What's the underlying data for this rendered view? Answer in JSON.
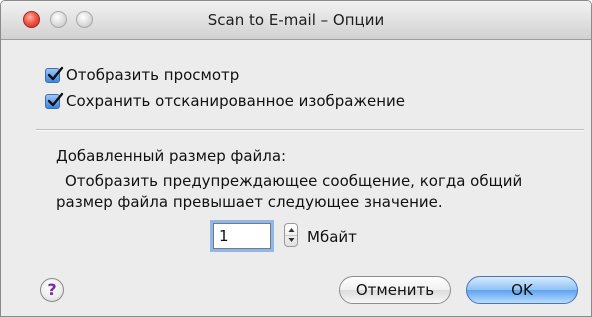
{
  "window": {
    "title": "Scan to E-mail – Опции"
  },
  "options": {
    "show_preview": {
      "label": "Отобразить просмотр",
      "checked": true
    },
    "save_scanned": {
      "label": "Сохранить отсканированное изображение",
      "checked": true
    }
  },
  "size": {
    "heading": "Добавленный размер файла:",
    "description_line1": "Отобразить предупреждающее сообщение, когда общий",
    "description_line2": "размер файла превышает следующее значение.",
    "value": "1",
    "unit": "Мбайт"
  },
  "buttons": {
    "help": "?",
    "cancel": "Отменить",
    "ok": "OK"
  },
  "colors": {
    "accent": "#5fa2ec",
    "checkbox": "#3f86e2",
    "help_mark": "#7a2a9b",
    "close_button": "#f25a4a"
  }
}
